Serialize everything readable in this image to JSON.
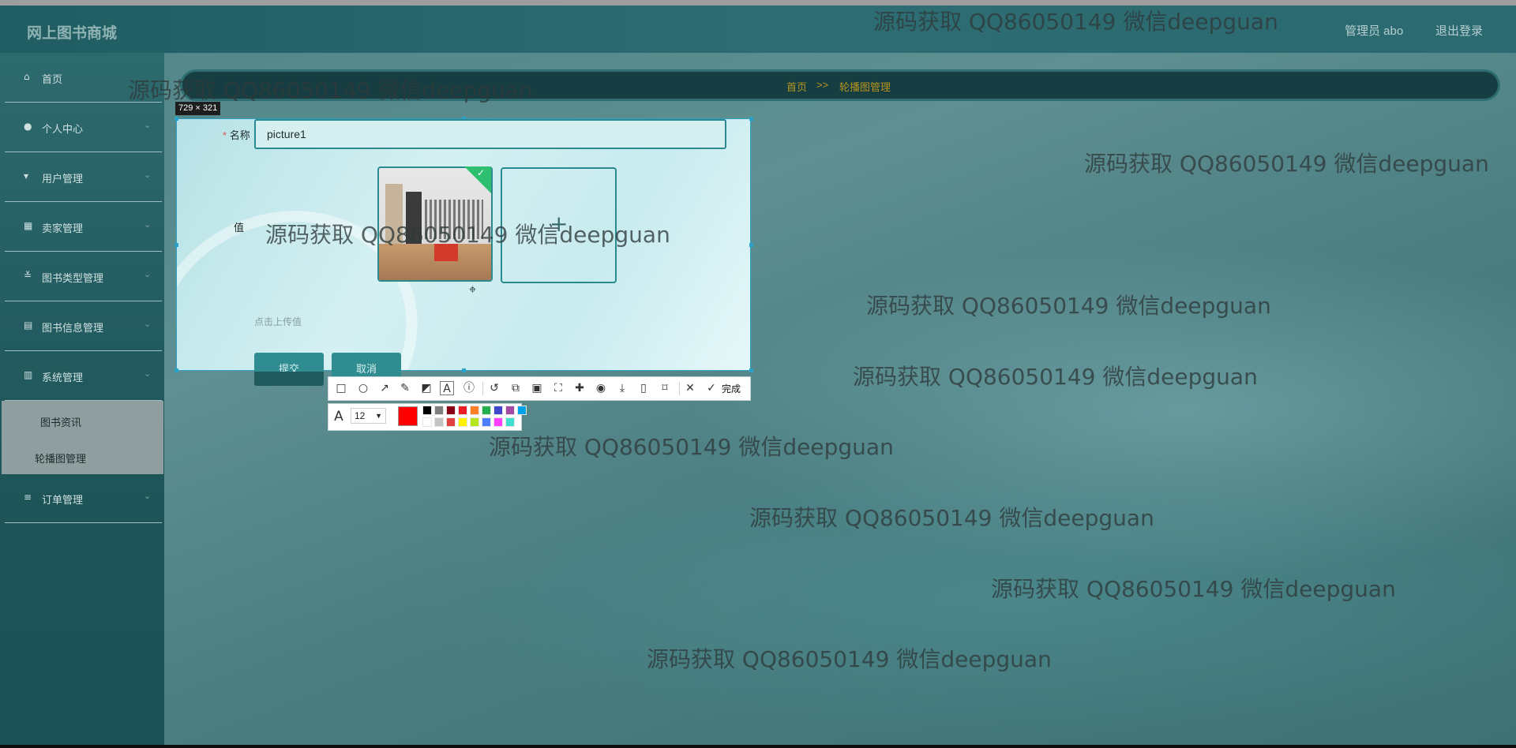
{
  "app": {
    "brand": "网上图书商城",
    "admin_label": "管理员 abo",
    "logout_label": "退出登录"
  },
  "sidebar": {
    "items": [
      {
        "label": "首页",
        "icon": "home-icon",
        "chevron": ""
      },
      {
        "label": "个人中心",
        "icon": "user-icon",
        "chevron": "⌄"
      },
      {
        "label": "用户管理",
        "icon": "users-icon",
        "chevron": "⌄"
      },
      {
        "label": "卖家管理",
        "icon": "grid-icon",
        "chevron": "⌄"
      },
      {
        "label": "图书类型管理",
        "icon": "sliders-icon",
        "chevron": "⌄"
      },
      {
        "label": "图书信息管理",
        "icon": "briefcase-icon",
        "chevron": "⌄"
      },
      {
        "label": "系统管理",
        "icon": "chart-icon",
        "chevron": "⌄"
      },
      {
        "label": "订单管理",
        "icon": "list-icon",
        "chevron": "⌄"
      }
    ],
    "subitems": [
      "图书资讯",
      "轮播图管理"
    ]
  },
  "breadcrumb": {
    "home": "首页",
    "separator": ">>",
    "current": "轮播图管理"
  },
  "form": {
    "name_label": "名称",
    "required_mark": "*",
    "name_value": "picture1",
    "value_label": "值",
    "plus_glyph": "+",
    "upload_hint": "点击上传值",
    "submit_label": "提交",
    "cancel_label": "取消"
  },
  "screenshot_tool": {
    "selection_size": "729 × 321",
    "done_label": "完成",
    "font_size": "12",
    "current_color": "#ff0000",
    "palette": [
      "#000000",
      "#7f7f7f",
      "#880015",
      "#ed1c24",
      "#ff7f27",
      "#22b14c",
      "#3f48cc",
      "#a349a4",
      "#00a2e8",
      "#ffffff",
      "#c3c3c3",
      "#e04040",
      "#fff200",
      "#b5e61d",
      "#4f7fff",
      "#ff40ff",
      "#40e0d0"
    ],
    "tools": [
      "rect-icon",
      "ellipse-icon",
      "arrow-icon",
      "pen-icon",
      "mosaic-icon",
      "text-icon",
      "serial-icon",
      "undo-icon",
      "crop-icon",
      "ocr-icon",
      "scan-icon",
      "pin-icon",
      "record-icon",
      "download-icon",
      "phone-icon",
      "bookmark-icon"
    ]
  },
  "watermark": {
    "text": "源码获取 QQ86050149 微信deepguan"
  },
  "colors": {
    "accent": "#2f8c90",
    "breadcrumb": "#b7941d",
    "selection": "#2da2c8"
  }
}
